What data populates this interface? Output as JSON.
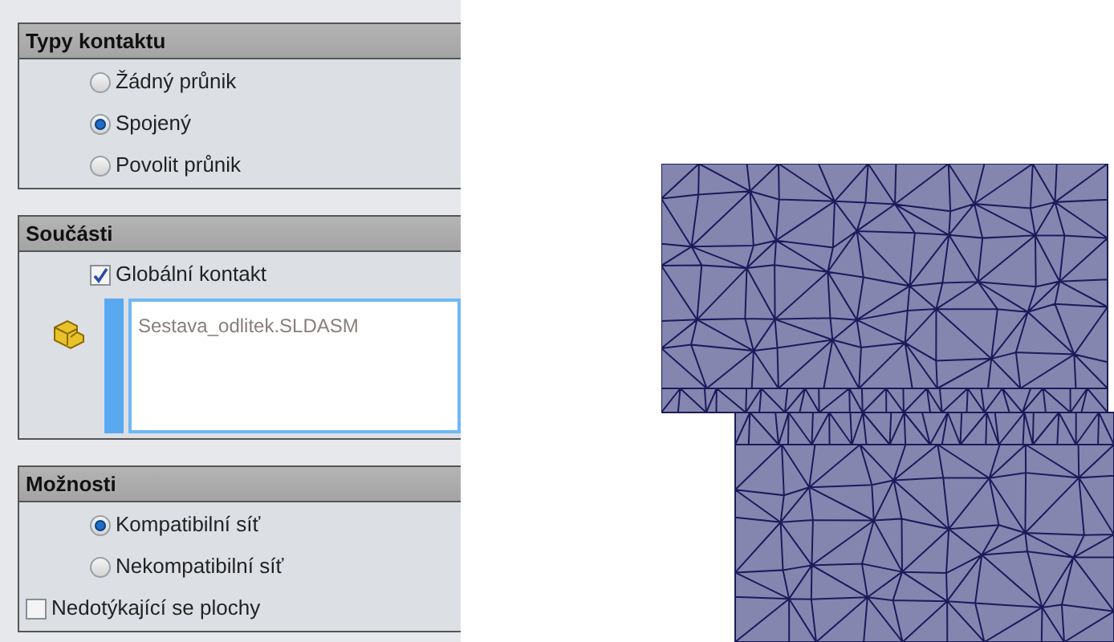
{
  "sections": [
    {
      "title": "Typy kontaktu",
      "items": [
        {
          "kind": "radio",
          "label": "Žádný průnik",
          "selected": false
        },
        {
          "kind": "radio",
          "label": "Spojený",
          "selected": true
        },
        {
          "kind": "radio",
          "label": "Povolit průnik",
          "selected": false
        }
      ]
    },
    {
      "title": "Součásti",
      "items": [
        {
          "kind": "checkbox",
          "label": "Globální kontakt",
          "checked": true
        },
        {
          "kind": "list",
          "entries": [
            "Sestava_odlitek.SLDASM"
          ]
        }
      ]
    },
    {
      "title": "Možnosti",
      "items": [
        {
          "kind": "radio",
          "label": "Kompatibilní síť",
          "selected": true
        },
        {
          "kind": "radio",
          "label": "Nekompatibilní síť",
          "selected": false
        },
        {
          "kind": "checkbox_left",
          "label": "Nedotýkající se plochy",
          "checked": false
        }
      ]
    }
  ]
}
